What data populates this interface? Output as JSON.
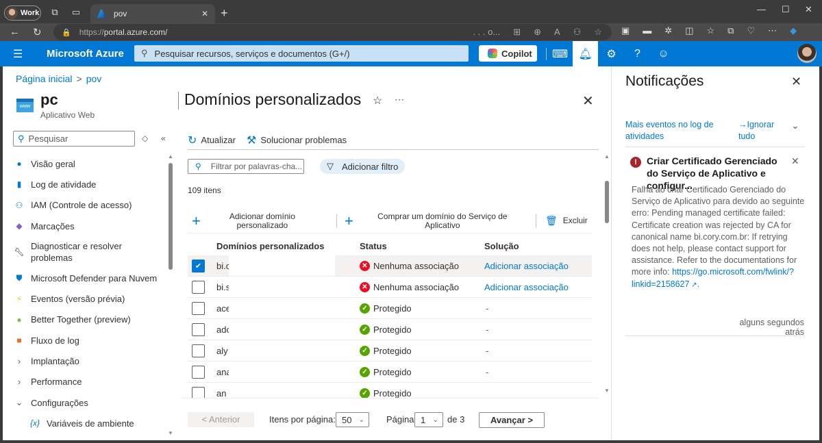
{
  "browser": {
    "profile_label": "Work",
    "tab_title": "pov",
    "url_protocol": "https://",
    "url_host": "portal.azure.com/",
    "url_suffix": ". . . o...",
    "new_tab_icon": "+",
    "minimize_icon": "—",
    "maximize_icon": "☐",
    "close_icon": "✕"
  },
  "header": {
    "brand": "Microsoft Azure",
    "search_placeholder": "Pesquisar recursos, serviços e documentos (G+/)",
    "copilot_label": "Copilot"
  },
  "breadcrumb": {
    "home": "Página inicial",
    "current": "pov"
  },
  "resource": {
    "name": "pc",
    "type": "Aplicativo Web",
    "icon_text": "www"
  },
  "sidebar": {
    "search_placeholder": "Pesquisar",
    "items": [
      {
        "label": "Visão geral",
        "icon": "globe-icon",
        "color": "#0078d4"
      },
      {
        "label": "Log de atividade",
        "icon": "log-icon",
        "color": "#0078d4"
      },
      {
        "label": "IAM (Controle de acesso)",
        "icon": "people-icon",
        "color": "#0078d4"
      },
      {
        "label": "Marcações",
        "icon": "tag-icon",
        "color": "#8661c5"
      },
      {
        "label": "Diagnosticar e resolver problemas",
        "icon": "wrench-icon",
        "color": "#323130"
      },
      {
        "label": "Microsoft Defender para Nuvem",
        "icon": "shield-icon",
        "color": "#0078d4"
      },
      {
        "label": "Eventos (versão prévia)",
        "icon": "lightning-icon",
        "color": "#f2c811"
      },
      {
        "label": "Better Together (preview)",
        "icon": "lightbulb-icon",
        "color": "#57a300"
      },
      {
        "label": "Fluxo de log",
        "icon": "stream-icon",
        "color": "#e8702a"
      },
      {
        "label": "Implantação",
        "icon": "chevron-right-icon",
        "expanded": false
      },
      {
        "label": "Performance",
        "icon": "chevron-right-icon",
        "expanded": false
      },
      {
        "label": "Configurações",
        "icon": "chevron-down-icon",
        "expanded": true
      },
      {
        "label": "Variáveis de ambiente",
        "icon": "variable-icon",
        "color": "#0078d4"
      }
    ]
  },
  "blade": {
    "title": "Domínios personalizados",
    "toolbar": {
      "refresh": "Atualizar",
      "troubleshoot": "Solucionar problemas"
    },
    "filter_placeholder": "Filtrar por palavras-cha...",
    "add_filter": "Adicionar filtro",
    "item_count": "109 itens",
    "actions": {
      "add_domain": "Adicionar domínio personalizado",
      "buy_domain": "Comprar um domínio do Serviço de Aplicativo",
      "delete": "Excluir"
    },
    "columns": [
      "Domínios personalizados",
      "Status",
      "Solução"
    ],
    "rows": [
      {
        "domain": "bi.c",
        "status": "Nenhuma associação",
        "status_type": "error",
        "solution": "Adicionar associação",
        "selected": true
      },
      {
        "domain": "bi.s",
        "status": "Nenhuma associação",
        "status_type": "error",
        "solution": "Adicionar associação",
        "selected": false
      },
      {
        "domain": "ace",
        "status": "Protegido",
        "status_type": "ok",
        "solution": "-",
        "selected": false
      },
      {
        "domain": "adc",
        "status": "Protegido",
        "status_type": "ok",
        "solution": "-",
        "selected": false
      },
      {
        "domain": "aly",
        "status": "Protegido",
        "status_type": "ok",
        "solution": "-",
        "selected": false
      },
      {
        "domain": "ana",
        "status": "Protegido",
        "status_type": "ok",
        "solution": "-",
        "selected": false
      },
      {
        "domain": "an",
        "status": "Protegido",
        "status_type": "ok",
        "solution": "",
        "selected": false
      }
    ],
    "pager": {
      "prev": "< Anterior",
      "per_page_label": "Itens por página:",
      "per_page": "50",
      "page_label": "Página",
      "page": "1",
      "of_label": "de 3",
      "next": "Avançar >"
    }
  },
  "notifications": {
    "title": "Notificações",
    "more_events": "Mais eventos no log de atividades",
    "dismiss_all": "→Ignorar tudo",
    "item": {
      "title": "Criar Certificado Gerenciado do Serviço de Aplicativo e configur...",
      "body": "Falha ao criar Certificado Gerenciado do Serviço de Aplicativo para devido ao seguinte erro: Pending managed certificate failed: Certificate creation was rejected by CA for canonical name bi.cory.com.br:  If retrying does not help, please contact support for assistance. Refer to the documentations for more info: ",
      "link": "https://go.microsoft.com/fwlink/?linkid=2158627",
      "link_suffix": ".",
      "time": "alguns segundos atrás"
    }
  },
  "colors": {
    "azure_blue": "#0078d4",
    "error": "#e81123",
    "success": "#57a300",
    "notif_error": "#a4262c"
  }
}
